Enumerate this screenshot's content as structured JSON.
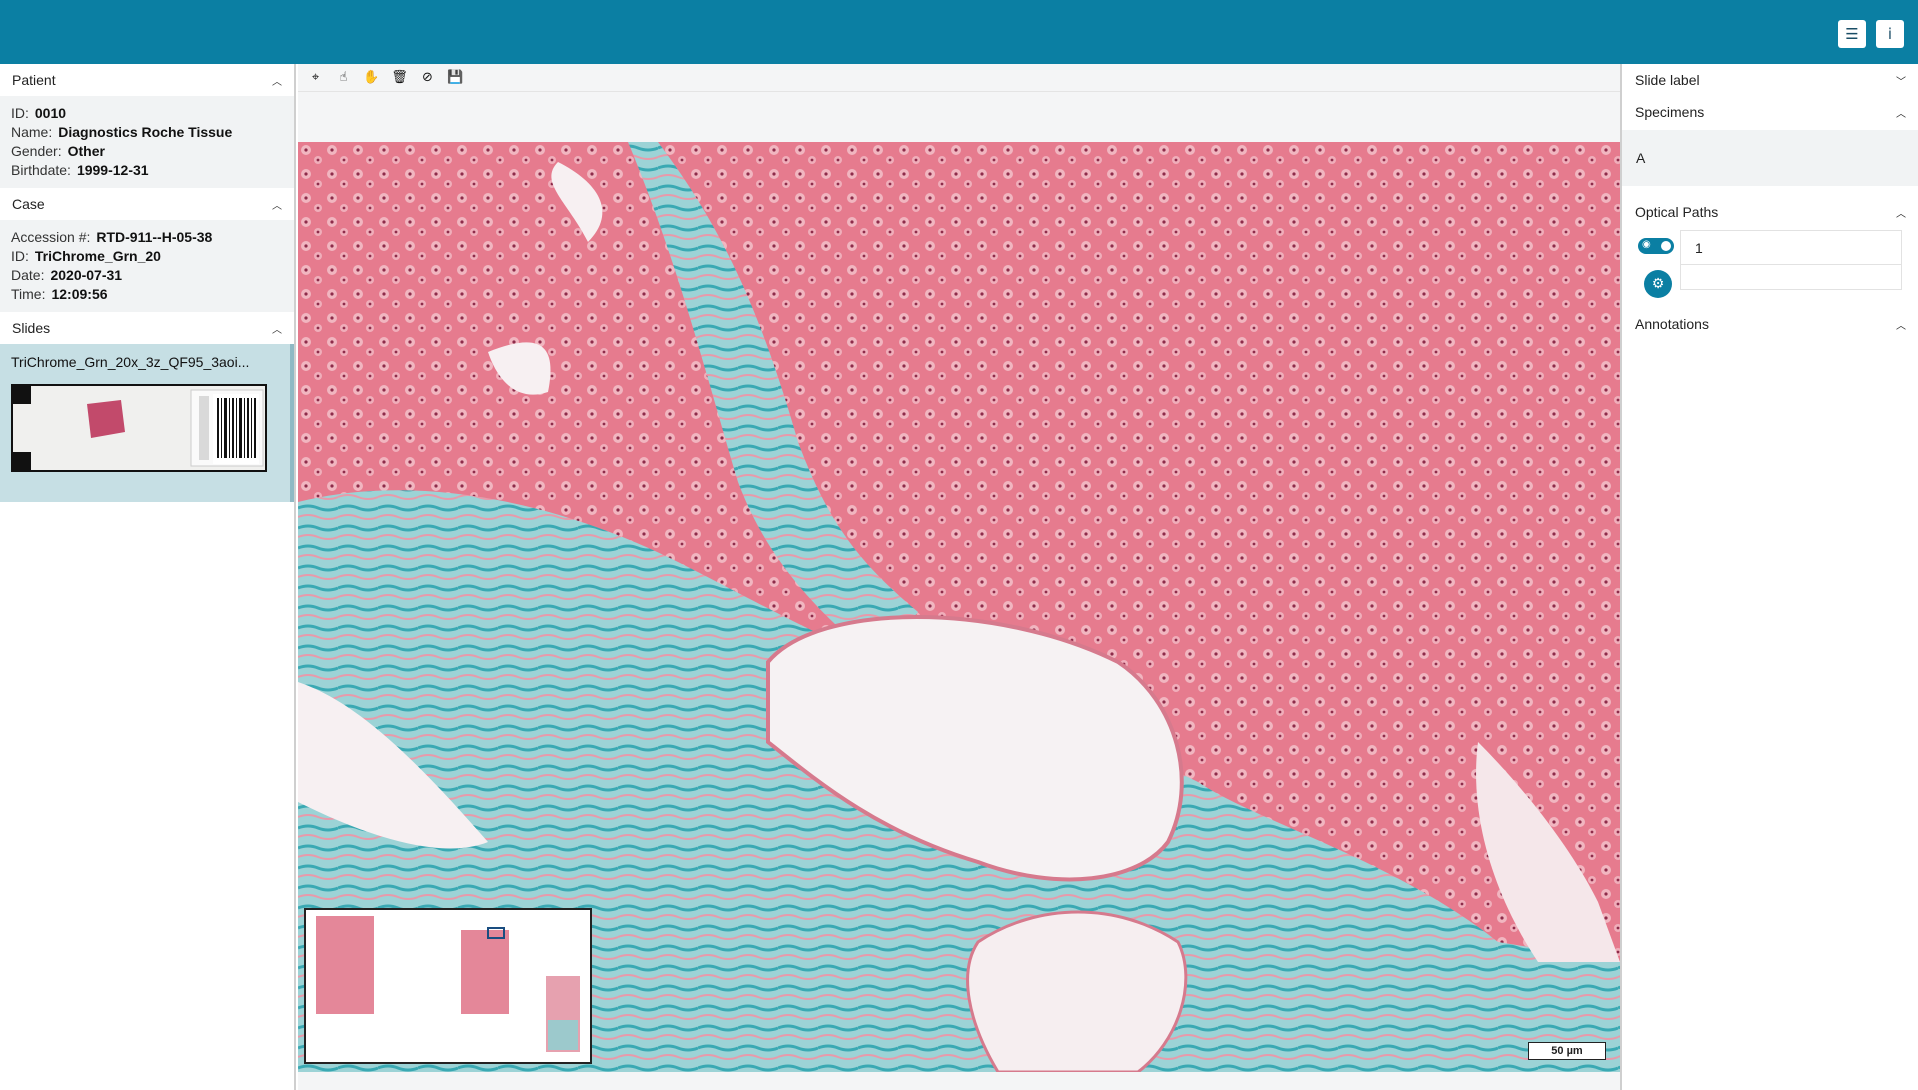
{
  "topbar": {
    "buttons": [
      {
        "icon": "list-icon",
        "glyph": "☰"
      },
      {
        "icon": "info-icon",
        "glyph": "i"
      }
    ]
  },
  "patient": {
    "title": "Patient",
    "rows": [
      {
        "key": "ID",
        "value": "0010"
      },
      {
        "key": "Name",
        "value": "Diagnostics Roche Tissue"
      },
      {
        "key": "Gender",
        "value": "Other"
      },
      {
        "key": "Birthdate",
        "value": "1999-12-31"
      }
    ]
  },
  "case": {
    "title": "Case",
    "rows": [
      {
        "key": "Accession #",
        "value": "RTD-911--H-05-38"
      },
      {
        "key": "ID",
        "value": "TriChrome_Grn_20"
      },
      {
        "key": "Date",
        "value": "2020-07-31"
      },
      {
        "key": "Time",
        "value": "12:09:56"
      }
    ]
  },
  "slides": {
    "title": "Slides",
    "items": [
      {
        "name": "TriChrome_Grn_20x_3z_QF95_3aoi..."
      }
    ]
  },
  "toolbar": {
    "tools": [
      {
        "name": "draw-roi-tool",
        "glyph": "⌖"
      },
      {
        "name": "select-tool",
        "glyph": "☝"
      },
      {
        "name": "pan-tool",
        "glyph": "✋"
      },
      {
        "name": "delete-tool",
        "glyph": "🗑"
      },
      {
        "name": "hide-annotations-tool",
        "glyph": "⊘"
      },
      {
        "name": "save-tool",
        "glyph": "💾"
      }
    ]
  },
  "viewer": {
    "scalebar": "50 µm"
  },
  "right": {
    "slide_label": "Slide label",
    "specimens": "Specimens",
    "specimen_value": "A",
    "optical_paths": "Optical Paths",
    "optical_path_value": "1",
    "annotations": "Annotations"
  },
  "colors": {
    "brand": "#0b7fa3",
    "tissue_pink": "#e8798c",
    "collagen_teal": "#52b8bf"
  }
}
